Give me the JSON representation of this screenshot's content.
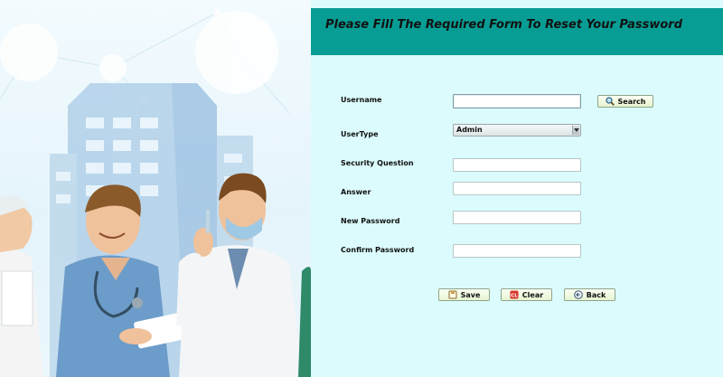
{
  "form": {
    "title": "Please Fill  The Required Form To Reset Your Password",
    "fields": {
      "username": {
        "label": "Username",
        "value": ""
      },
      "usertype": {
        "label": "UserType",
        "value": "Admin"
      },
      "security_question": {
        "label": "Security Question",
        "value": ""
      },
      "answer": {
        "label": "Answer",
        "value": ""
      },
      "new_password": {
        "label": "New Password",
        "value": ""
      },
      "confirm_password": {
        "label": "Confirm Password",
        "value": ""
      }
    },
    "buttons": {
      "search": {
        "label": "Search",
        "icon": "search-icon"
      },
      "save": {
        "label": "Save",
        "icon": "save-icon"
      },
      "clear": {
        "label": "Clear",
        "icon": "clear-icon"
      },
      "back": {
        "label": "Back",
        "icon": "back-icon"
      }
    }
  },
  "colors": {
    "header": "#079d94",
    "panel": "#dbfbfc",
    "button": "#e6f4cf"
  }
}
